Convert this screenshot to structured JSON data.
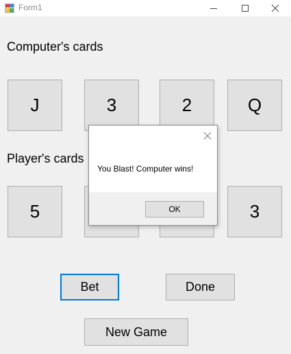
{
  "window": {
    "title": "Form1"
  },
  "computer": {
    "label": "Computer's cards",
    "cards": [
      "J",
      "3",
      "2",
      "Q"
    ]
  },
  "player": {
    "label": "Player's cards",
    "cards": [
      "5",
      "",
      "",
      "3"
    ]
  },
  "buttons": {
    "bet": "Bet",
    "done": "Done",
    "new_game": "New Game"
  },
  "dialog": {
    "message": "You Blast! Computer wins!",
    "ok": "OK"
  },
  "icons": {
    "app": "form-app-icon",
    "minimize": "minimize-icon",
    "maximize": "maximize-icon",
    "close": "close-icon",
    "dialog_close": "dialog-close-icon"
  },
  "colors": {
    "focus": "#0078d7",
    "background": "#f0f0f0",
    "button": "#e1e1e1"
  }
}
